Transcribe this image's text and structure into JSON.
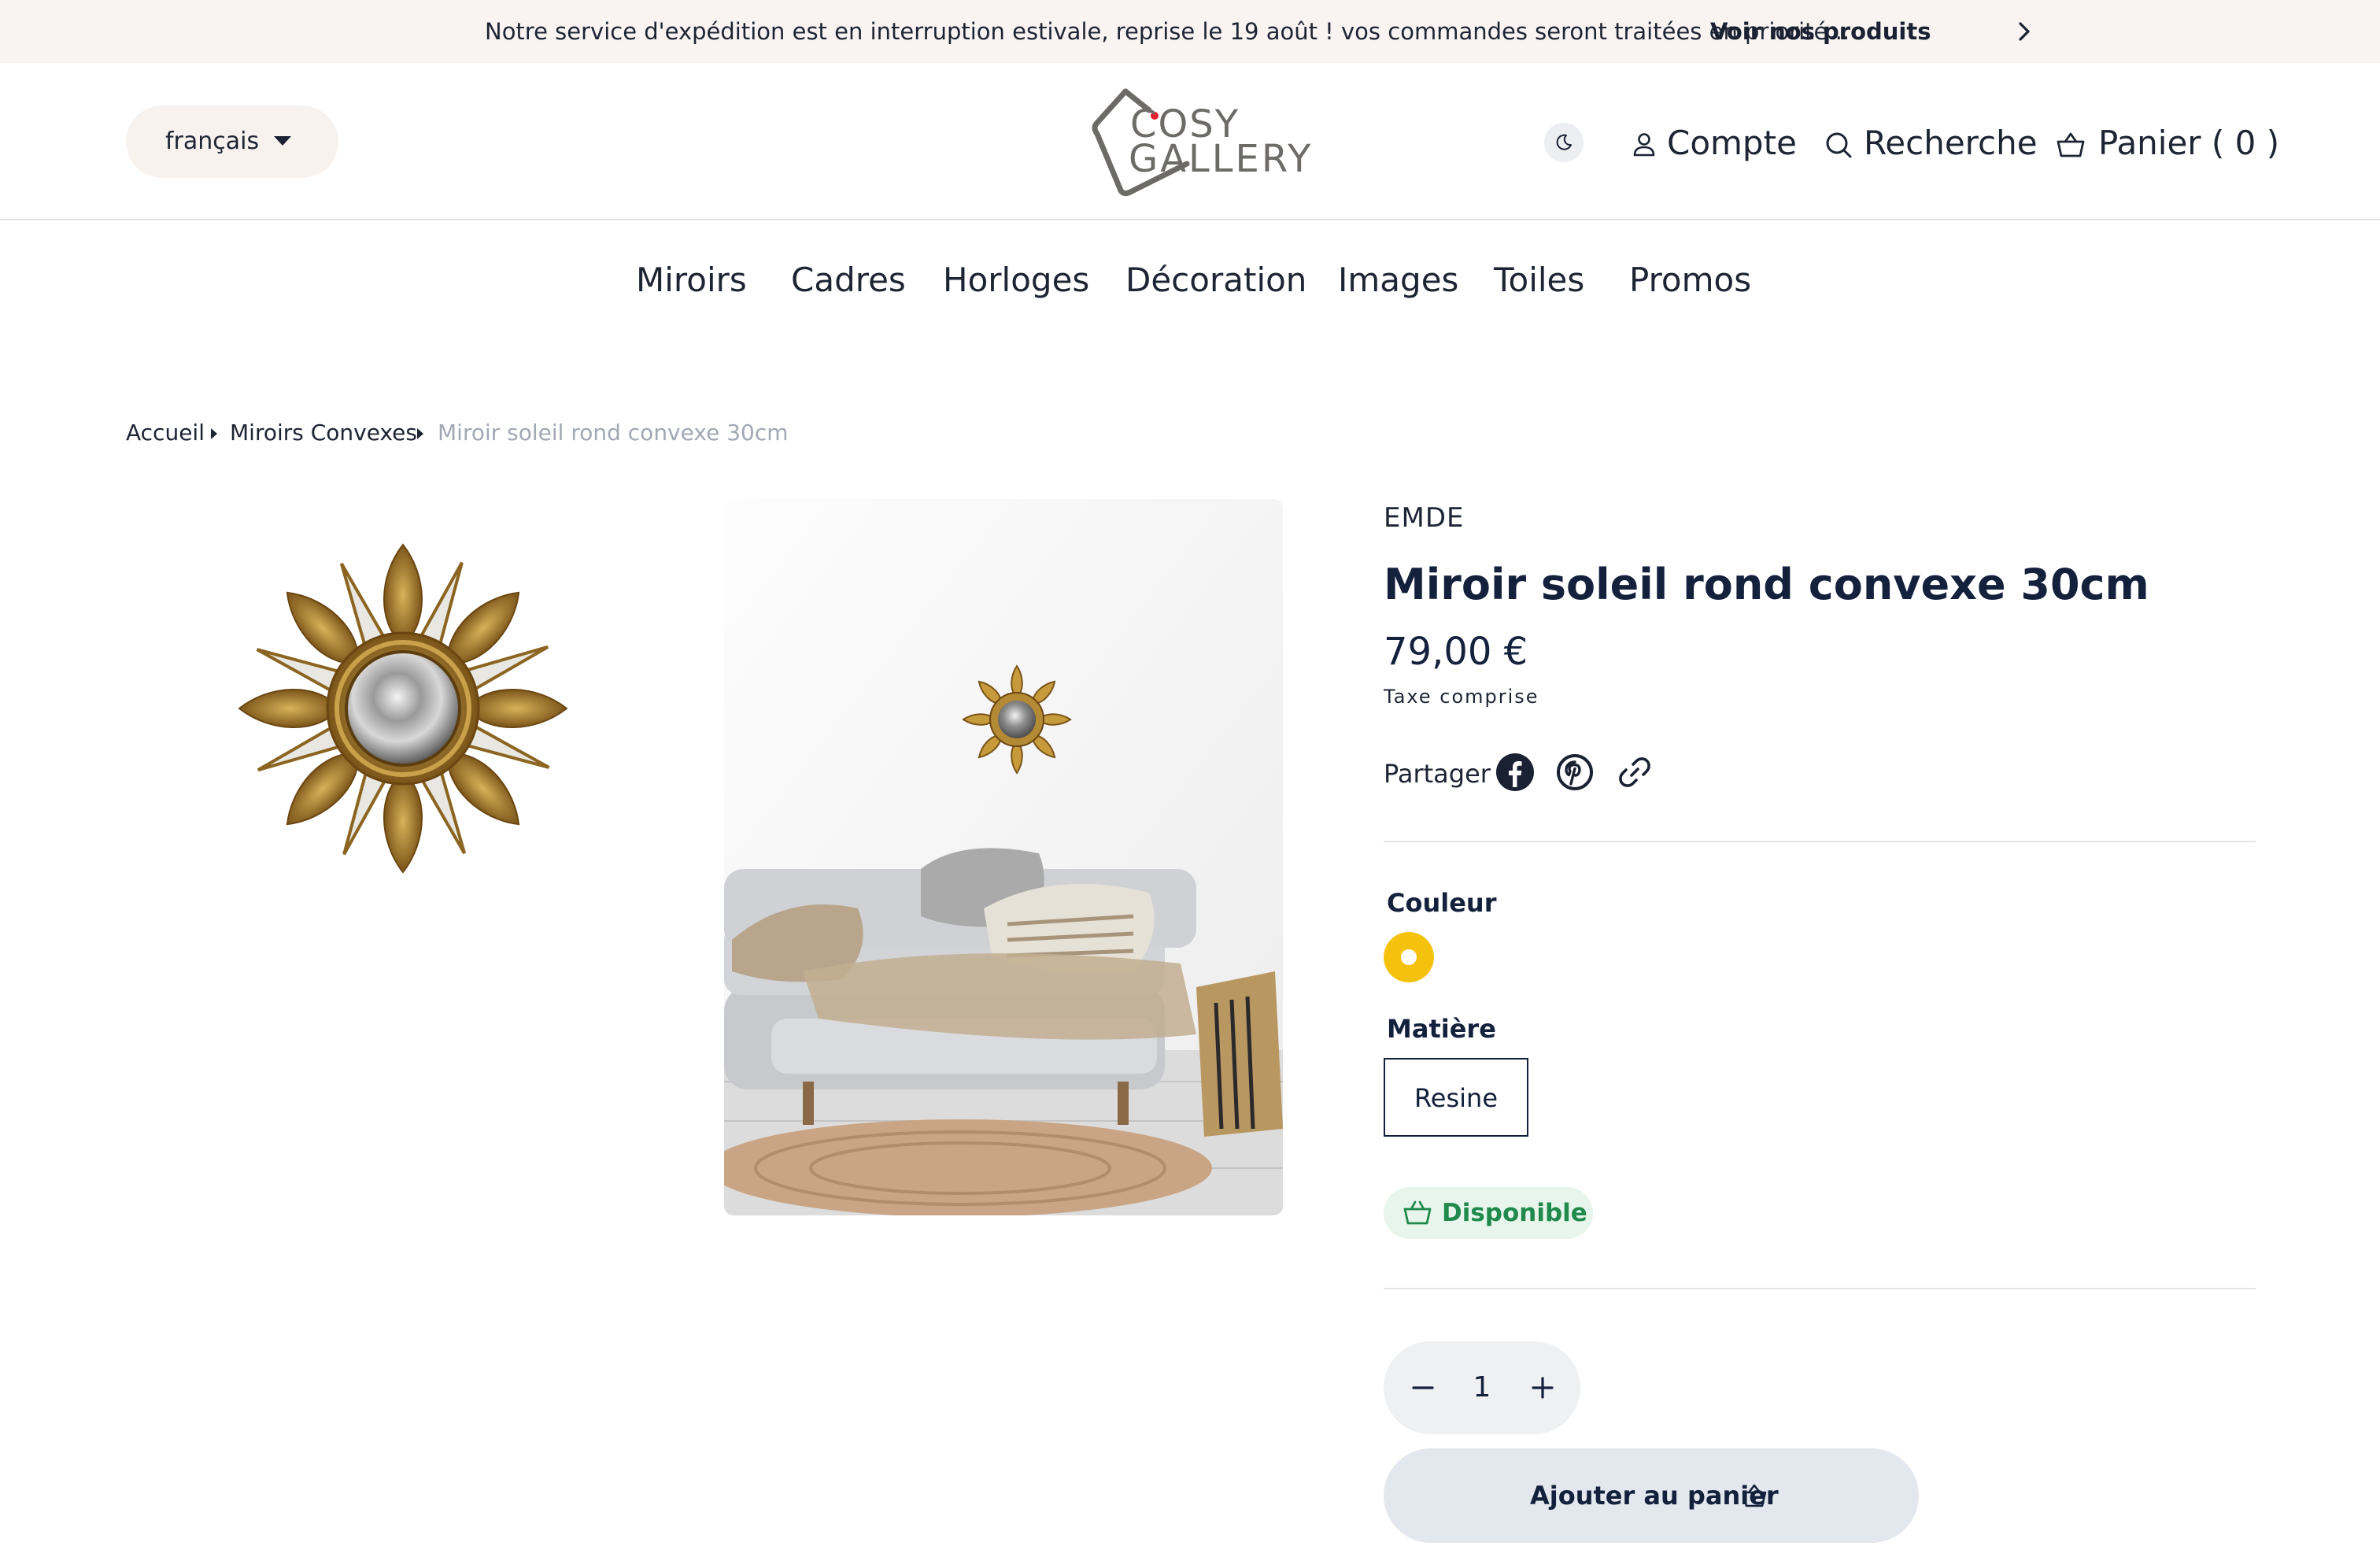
{
  "announcement": {
    "text": "Notre service d'expédition est en interruption estivale, reprise le 19 août ! vos commandes seront traitées en priorité...",
    "link": "Voir nos produits",
    "next_icon": "chevron-right-icon"
  },
  "header": {
    "language": "français",
    "logo_line1": "COSY",
    "logo_line2": "GALLERY",
    "theme_icon": "moon-icon",
    "account": "Compte",
    "search": "Recherche",
    "cart": "Panier ( 0 )"
  },
  "nav": {
    "items": [
      {
        "label": "Miroirs"
      },
      {
        "label": "Cadres"
      },
      {
        "label": "Horloges"
      },
      {
        "label": "Décoration"
      },
      {
        "label": "Images"
      },
      {
        "label": "Toiles"
      },
      {
        "label": "Promos"
      }
    ]
  },
  "breadcrumb": {
    "items": [
      "Accueil",
      "Miroirs Convexes",
      "Miroir soleil rond convexe 30cm"
    ]
  },
  "product": {
    "vendor": "EMDE",
    "title": "Miroir soleil rond convexe 30cm",
    "price": "79,00 €",
    "tax_note": "Taxe comprise",
    "share_label": "Partager",
    "share_icons": [
      "facebook-icon",
      "pinterest-icon",
      "link-icon"
    ],
    "color_label": "Couleur",
    "color_swatch": "#F4C20D",
    "material_label": "Matière",
    "material_value": "Resine",
    "stock_status": "Disponible",
    "quantity": "1",
    "add_to_cart": "Ajouter au panier"
  },
  "colors": {
    "announcement_bg": "#F9F3F1",
    "text": "#14213D",
    "stock_green": "#1F8A4C",
    "button_bg": "#E3E7EE"
  }
}
